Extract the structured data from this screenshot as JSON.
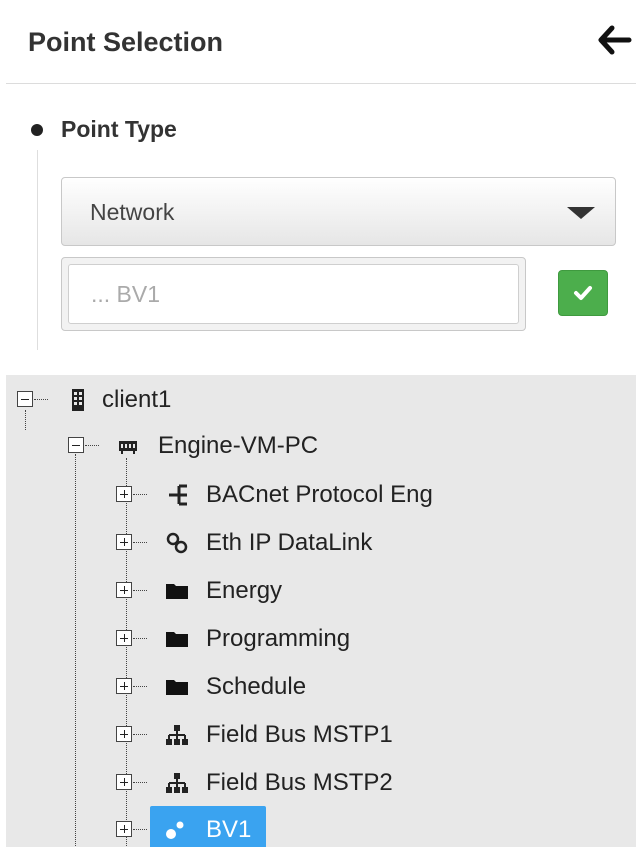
{
  "header": {
    "title": "Point Selection",
    "back_icon": "arrow-left-icon"
  },
  "point_type": {
    "label": "Point Type",
    "select": {
      "value": "Network"
    },
    "search": {
      "value": "",
      "placeholder": "... BV1"
    },
    "confirm_icon": "check-icon",
    "confirm_color": "#4cae4c"
  },
  "tree": {
    "root": {
      "label": "client1",
      "icon": "building-icon",
      "state": "expanded"
    },
    "device": {
      "label": "Engine-VM-PC",
      "icon": "server-icon",
      "state": "expanded"
    },
    "children": [
      {
        "label": "BACnet Protocol Eng",
        "icon": "network-protocol-icon"
      },
      {
        "label": "Eth IP DataLink",
        "icon": "link-icon"
      },
      {
        "label": "Energy",
        "icon": "folder-icon"
      },
      {
        "label": "Programming",
        "icon": "folder-icon"
      },
      {
        "label": "Schedule",
        "icon": "folder-icon"
      },
      {
        "label": "Field Bus MSTP1",
        "icon": "sitemap-icon"
      },
      {
        "label": "Field Bus MSTP2",
        "icon": "sitemap-icon"
      },
      {
        "label": "BV1",
        "icon": "point-icon",
        "selected": true
      }
    ],
    "selected_color": "#3aa3f0"
  }
}
